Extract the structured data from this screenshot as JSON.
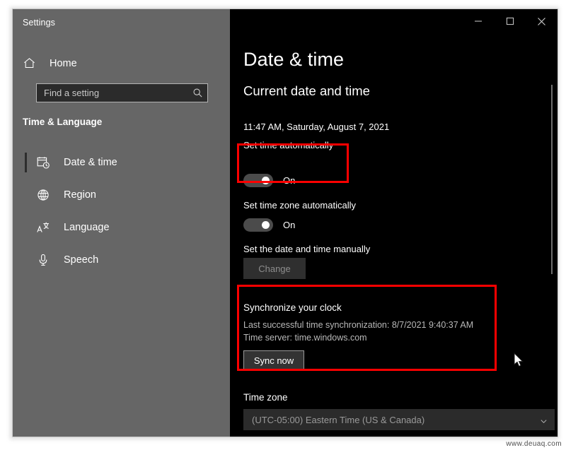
{
  "window": {
    "app_title": "Settings",
    "controls": {
      "minimize": "minimize-icon",
      "maximize": "maximize-icon",
      "close": "close-icon"
    }
  },
  "sidebar": {
    "home_label": "Home",
    "home_icon": "home-icon",
    "search": {
      "placeholder": "Find a setting",
      "value": "",
      "icon": "search-icon"
    },
    "group_title": "Time & Language",
    "items": [
      {
        "label": "Date & time",
        "icon": "calendar-clock-icon",
        "selected": true
      },
      {
        "label": "Region",
        "icon": "globe-icon",
        "selected": false
      },
      {
        "label": "Language",
        "icon": "language-icon",
        "selected": false
      },
      {
        "label": "Speech",
        "icon": "microphone-icon",
        "selected": false
      }
    ]
  },
  "main": {
    "page_title": "Date & time",
    "current_section": {
      "heading": "Current date and time",
      "value": "11:47 AM, Saturday, August 7, 2021"
    },
    "set_time_automatically": {
      "label": "Set time automatically",
      "state": "On",
      "highlighted": true
    },
    "set_timezone_automatically": {
      "label": "Set time zone automatically",
      "state": "On",
      "highlighted": false
    },
    "manual": {
      "label": "Set the date and time manually",
      "button_label": "Change",
      "button_disabled": true
    },
    "synchronize": {
      "heading": "Synchronize your clock",
      "last_sync": "Last successful time synchronization: 8/7/2021 9:40:37 AM",
      "time_server": "Time server: time.windows.com",
      "button_label": "Sync now",
      "highlighted": true
    },
    "timezone": {
      "label": "Time zone",
      "selected": "(UTC-05:00) Eastern Time (US & Canada)",
      "arrow_icon": "chevron-down-icon"
    }
  },
  "annotation": {
    "color": "#ff0000"
  },
  "watermark": {
    "text": "www.deuaq.com"
  }
}
